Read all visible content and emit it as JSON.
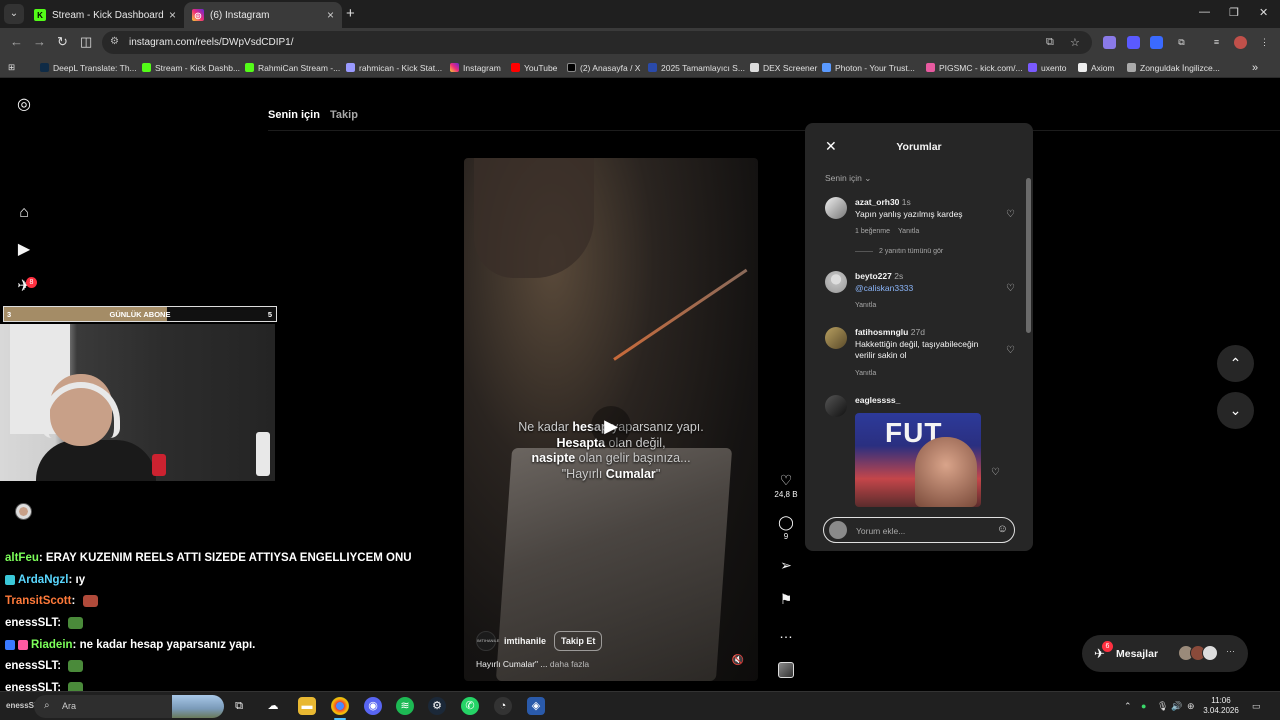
{
  "browser": {
    "tabs": [
      {
        "title": "Stream - Kick Dashboard",
        "active": false
      },
      {
        "title": "(6) Instagram",
        "active": true
      }
    ],
    "url": "instagram.com/reels/DWpVsdCDIP1/",
    "bookmarks": [
      "DeepL Translate: Th...",
      "Stream - Kick Dashb...",
      "RahmiCan Stream -...",
      "rahmican - Kick Stat...",
      "Instagram",
      "YouTube",
      "(2) Anasayfa / X",
      "2025 Tamamlayıcı S...",
      "DEX Screener",
      "Photon - Your Trust...",
      "PIGSMC - kick.com/...",
      "uxento",
      "Axiom",
      "Zonguldak İngilizce..."
    ]
  },
  "instagram": {
    "notification_count": "8",
    "feed_tabs": [
      "Senin için",
      "Takip"
    ],
    "reel": {
      "caption_lines": [
        {
          "pre": "Ne kadar ",
          "bold": "hesap",
          "post": " yaparsanız yapı."
        },
        {
          "pre": "",
          "bold": "Hesapta",
          "post": " olan değil,"
        },
        {
          "pre": "",
          "bold": "nasipte",
          "post": " olan gelir başınıza..."
        },
        {
          "pre": "\"Hayırlı ",
          "bold": "Cumalar",
          "post": "\""
        }
      ],
      "username": "imtihanile",
      "avatar_text": "IMTIHANILE",
      "follow_label": "Takip Et",
      "description": "Hayırlı Cumalar\" ...",
      "more_label": "daha fazla",
      "likes": "24,8 B",
      "comments": "9"
    },
    "comments_panel": {
      "title": "Yorumlar",
      "filter": "Senin için",
      "comments": [
        {
          "user": "azat_orh30",
          "time": "1s",
          "text": "Yapın yanlış yazılmış kardeş",
          "meta": [
            "1 beğenme",
            "Yanıtla"
          ]
        },
        {
          "user": "beyto227",
          "time": "2s",
          "text": "@caliskan3333",
          "meta": [
            "Yanıtla"
          ]
        },
        {
          "user": "fatihosmnglu",
          "time": "27d",
          "text": "Hakkettiğin değil, taşıyabileceğin verilir sakin ol",
          "meta": [
            "Yanıtla"
          ]
        },
        {
          "user": "eaglessss_",
          "time": "",
          "text": "",
          "meta": []
        }
      ],
      "view_replies": "2 yanıtın tümünü gör",
      "gif_text": "FUT",
      "input_placeholder": "Yorum ekle..."
    },
    "messages": {
      "label": "Mesajlar",
      "badge": "6"
    }
  },
  "stream_overlay": {
    "sub_goal": {
      "label": "GÜNLÜK ABONE",
      "start": "3",
      "end": "5",
      "progress": 0.6
    },
    "chat": [
      {
        "user": "altFeu",
        "color": "#7cff5a",
        "text": "ERAY KUZENIM REELS ATTI SIZEDE ATTIYSA ENGELLIYCEM ONU"
      },
      {
        "user": "ArdaNgzl",
        "color": "#5ad8ff",
        "text": "ıy"
      },
      {
        "user": "TransitScott",
        "color": "#ff7a3a",
        "text": ""
      },
      {
        "user": "enessSLT",
        "color": "#ffffff",
        "text": ""
      },
      {
        "user": "Riadein",
        "color": "#7cff5a",
        "text": "ne kadar hesap yaparsanız yapı."
      },
      {
        "user": "enessSLT",
        "color": "#ffffff",
        "text": ""
      },
      {
        "user": "enessSLT",
        "color": "#ffffff",
        "text": ""
      },
      {
        "user": "enessSLT",
        "color": "#ffffff",
        "text": ""
      }
    ]
  },
  "taskbar": {
    "search_placeholder": "Ara",
    "time": "11:06",
    "date": "3.04.2026"
  }
}
